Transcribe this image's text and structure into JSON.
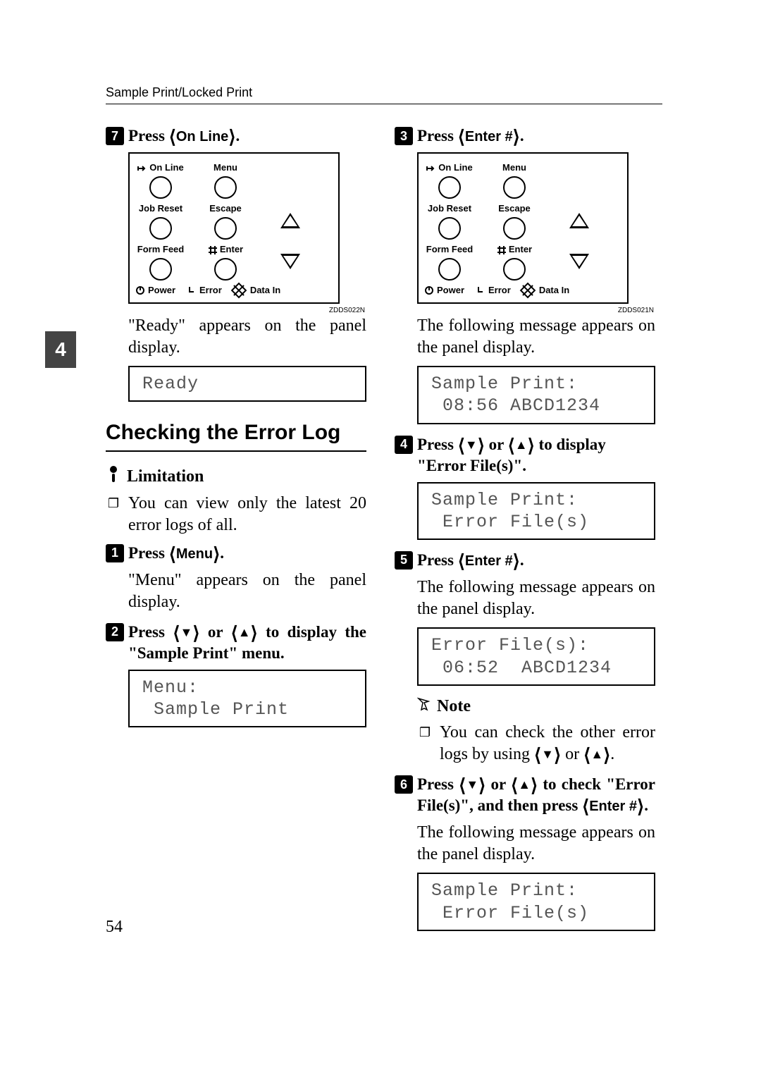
{
  "running_head": "Sample Print/Locked Print",
  "page_number": "54",
  "side_tab": "4",
  "panel_labels": {
    "online": "On Line",
    "menu": "Menu",
    "jobreset": "Job Reset",
    "escape": "Escape",
    "formfeed": "Form Feed",
    "enter": "Enter",
    "power": "Power",
    "error": "Error",
    "datain": "Data In"
  },
  "fig_ids": [
    "ZDDS022N",
    "ZDDS021N"
  ],
  "left": {
    "step7": {
      "press": "Press ",
      "key": "On Line",
      "tail": "."
    },
    "after7": "\"Ready\" appears on the panel display.",
    "lcd_ready": "Ready",
    "h2": "Checking the Error Log",
    "limitation_label": "Limitation",
    "limitation_text": "You can view only the latest 20 error logs of all.",
    "step1": {
      "press": "Press ",
      "key": "Menu",
      "tail": "."
    },
    "after1": "\"Menu\" appears on the panel display.",
    "step2_a": "Press ",
    "step2_b": " or ",
    "step2_c": " to display the \"Sample Print\" menu.",
    "lcd_menu": "Menu:\n Sample Print"
  },
  "right": {
    "step3": {
      "press": "Press ",
      "key": "Enter #",
      "tail": "."
    },
    "after3": "The following message appears on the panel display.",
    "lcd3": "Sample Print:\n 08:56 ABCD1234",
    "step4_a": "Press ",
    "step4_b": " or ",
    "step4_c": " to display \"Error File(s)\".",
    "lcd4": "Sample Print:\n Error File(s)",
    "step5": {
      "press": "Press ",
      "key": "Enter #",
      "tail": "."
    },
    "after5": "The following message appears on the panel display.",
    "lcd5": "Error File(s):\n 06:52  ABCD1234",
    "note_label": "Note",
    "note_a": "You can check the other error logs by using ",
    "note_b": " or ",
    "note_c": ".",
    "step6_a": "Press ",
    "step6_b": " or ",
    "step6_c": " to check \"Error File(s)\", and then press ",
    "step6_key": "Enter #",
    "step6_d": ".",
    "after6": "The following message appears on the panel display.",
    "lcd6": "Sample Print:\n Error File(s)"
  }
}
